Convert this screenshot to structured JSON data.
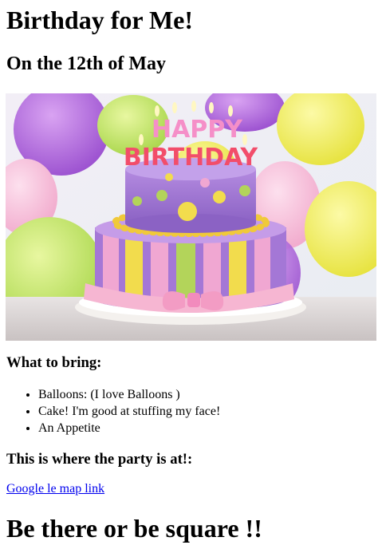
{
  "page": {
    "title": "Birthday for Me!",
    "date_heading": "On the 12th of May",
    "image": {
      "alt": "Birthday cake with HAPPY BIRTHDAY candles and balloons",
      "candle_text_line1": "HAPPY",
      "candle_text_line2": "BIRTHDAY"
    },
    "bring_heading": "What to bring:",
    "bring_items": [
      "Balloons: (I love Balloons )",
      "Cake! I'm good at stuffing my face!",
      "An Appetite"
    ],
    "party_heading": "This is where the party is at!:",
    "map_link_text": "Google le map link",
    "closing": "Be there or be square !!"
  },
  "colors": {
    "link": "#0000ee",
    "text": "#000000"
  }
}
